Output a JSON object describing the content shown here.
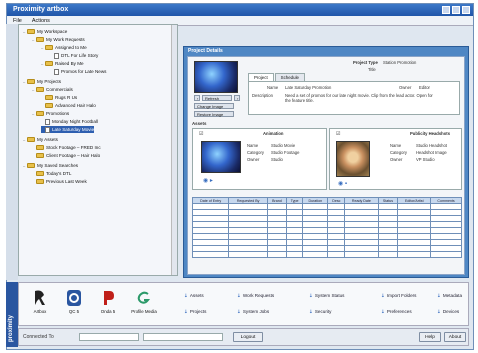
{
  "app": {
    "title": "Proximity artbox",
    "brand": "proximity"
  },
  "menu": {
    "file": "File",
    "actions": "Actions"
  },
  "tree": [
    {
      "label": "My Workspace",
      "icon": "folder",
      "expander": "–"
    },
    {
      "label": "My Work Requests",
      "icon": "folder",
      "expander": "–"
    },
    {
      "label": "Assigned to Me",
      "icon": "folder",
      "expander": "–"
    },
    {
      "label": "DTL For Life Story",
      "icon": "doc",
      "expander": ""
    },
    {
      "label": "Raised By Me",
      "icon": "folder",
      "expander": "–"
    },
    {
      "label": "Promos for Late News",
      "icon": "doc",
      "expander": ""
    },
    {
      "label": "My Projects",
      "icon": "folder",
      "expander": "–"
    },
    {
      "label": "Commercials",
      "icon": "folder",
      "expander": "–"
    },
    {
      "label": "Rugs R Us",
      "icon": "folder",
      "expander": ""
    },
    {
      "label": "Advanced Hair Halo",
      "icon": "folder",
      "expander": ""
    },
    {
      "label": "Promotions",
      "icon": "folder",
      "expander": "–"
    },
    {
      "label": "Monday Night Football",
      "icon": "doc",
      "expander": ""
    },
    {
      "label": "Late Saturday Movie",
      "icon": "doc",
      "expander": ""
    },
    {
      "label": "My Assets",
      "icon": "folder",
      "expander": "–"
    },
    {
      "label": "Stock Footage – FRED Inc",
      "icon": "folder",
      "expander": ""
    },
    {
      "label": "Client Footage – Hair Halo",
      "icon": "folder",
      "expander": ""
    },
    {
      "label": "My Saved Searches",
      "icon": "folder",
      "expander": "–"
    },
    {
      "label": "Today's DTL",
      "icon": "folder",
      "expander": ""
    },
    {
      "label": "Previous Last Week",
      "icon": "folder",
      "expander": ""
    }
  ],
  "project": {
    "panel_title": "Project Details",
    "type_label": "Project Type",
    "type_value": "Station Promotion",
    "title_label": "Title",
    "buttons": [
      "Refresh",
      "Change Image",
      "Restore Image"
    ],
    "tabs": [
      "Project",
      "Schedule"
    ],
    "fields": [
      {
        "label": "Name",
        "value": "Late Saturday Promotion"
      },
      {
        "label": "Owner",
        "value": "Editor"
      },
      {
        "label": "Description",
        "value": "Need a set of promos for our late night movie. Clip from the lead actor. Open for the feature title."
      }
    ],
    "assets_title": "Assets",
    "animation_label": "Animation",
    "animation_fields": [
      {
        "label": "Name",
        "value": "Studio Movie"
      },
      {
        "label": "Category",
        "value": "Studio Footage"
      },
      {
        "label": "Owner",
        "value": "Studio"
      }
    ],
    "ref_label": "Publicity Headshots",
    "ref_fields": [
      {
        "label": "Name",
        "value": "Studio Headshot"
      },
      {
        "label": "Category",
        "value": "Headshot Image"
      },
      {
        "label": "Owner",
        "value": "VP Studio"
      }
    ],
    "grid_headers": [
      "Date of Entry",
      "Requested By",
      "Brand",
      "Type",
      "Duration",
      "Desc",
      "Ready Date",
      "Status",
      "Editor/Artist",
      "Comments"
    ]
  },
  "apps": [
    {
      "label": "Artbox",
      "icon": "artbox-icon",
      "color": "#222222"
    },
    {
      "label": "QC 5",
      "icon": "qc-icon",
      "color": "#2a56a0"
    },
    {
      "label": "Onda 5",
      "icon": "onda-icon",
      "color": "#c0201a"
    },
    {
      "label": "Profile Media",
      "icon": "media-icon",
      "color": "#2c9a6a"
    }
  ],
  "links": [
    [
      "Assets",
      "Work Requests",
      "System Status",
      "Import Folders",
      "Metadata"
    ],
    [
      "Projects",
      "System Jobs",
      "Security",
      "Preferences",
      "Devices"
    ]
  ],
  "status": {
    "connected_label": "Connected To",
    "logout": "Logout",
    "help": "Help",
    "about": "About"
  }
}
